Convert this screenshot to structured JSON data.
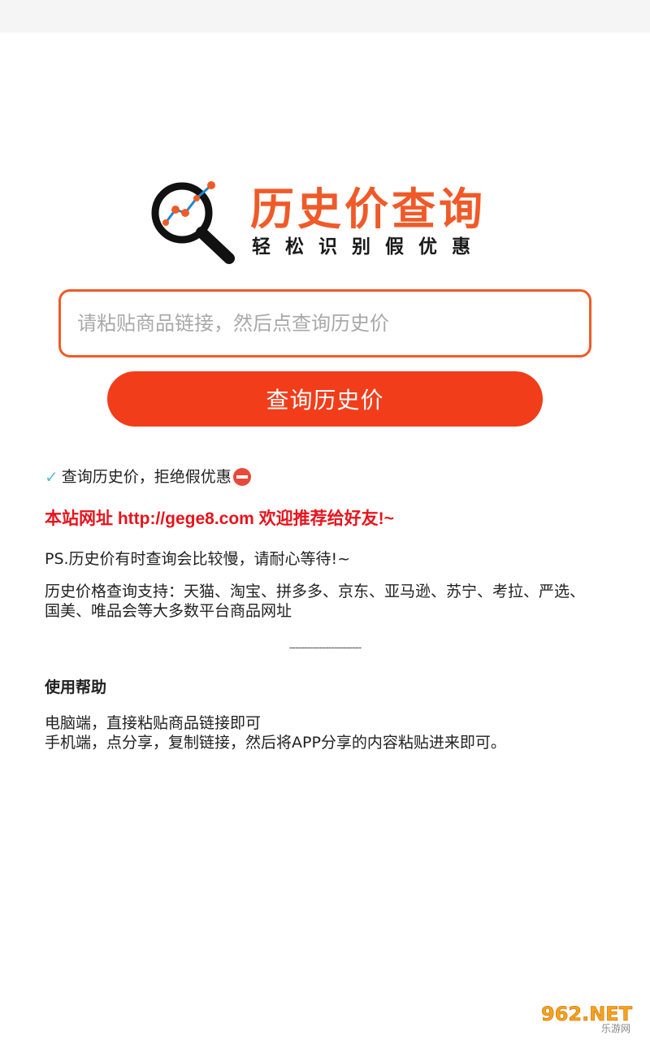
{
  "logo": {
    "title": "历史价查询",
    "subtitle": "轻松识别假优惠"
  },
  "search": {
    "placeholder": "请粘贴商品链接，然后点查询历史价",
    "value": ""
  },
  "query_button": {
    "label": "查询历史价"
  },
  "info": {
    "tagline": "查询历史价，拒绝假优惠",
    "site_line": "本站网址 http://gege8.com 欢迎推荐给好友!~",
    "ps_line": "PS.历史价有时查询会比较慢，请耐心等待!~",
    "support_line": "历史价格查询支持：天猫、淘宝、拼多多、京东、亚马逊、苏宁、考拉、严选、国美、唯品会等大多数平台商品网址",
    "divider": "------------------------",
    "help_title": "使用帮助",
    "help_pc": "电脑端，直接粘贴商品链接即可",
    "help_mobile": "手机端，点分享，复制链接，然后将APP分享的内容粘贴进来即可。"
  },
  "watermark": {
    "text": "962.NET",
    "subtext": "乐游网"
  },
  "colors": {
    "accent": "#f05a28",
    "button": "#f23d1b",
    "link_red": "#e8131c"
  },
  "icons": {
    "logo": "magnifier-chart-icon",
    "check": "check-icon",
    "stop": "no-entry-icon"
  }
}
